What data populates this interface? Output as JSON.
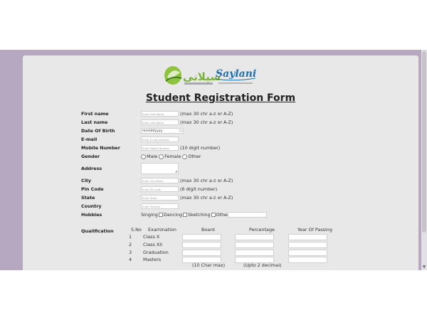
{
  "form": {
    "title": "Student Registration Form",
    "logo": {
      "urdu": "سیلانی",
      "latin": "Saylani"
    }
  },
  "fields": {
    "first_name": {
      "label": "First name",
      "placeholder": "Enter First Name",
      "hint": "(max 30 chr a-z or A-Z)"
    },
    "last_name": {
      "label": "Last name",
      "placeholder": "Enter Last Name",
      "hint": "(max 30 chr a-z or A-Z)"
    },
    "dob": {
      "label": "Date Of Birth",
      "value": "mm/dd/yyyy",
      "icon": "calendar-icon"
    },
    "email": {
      "label": "E-mail",
      "placeholder": "Enter E-mail address"
    },
    "mobile": {
      "label": "Mobile Number",
      "placeholder": "Enter Mobile Number",
      "hint": "(10 digit number)"
    },
    "gender": {
      "label": "Gender",
      "options": [
        "Male",
        "Female",
        "Other"
      ]
    },
    "address": {
      "label": "Address"
    },
    "city": {
      "label": "City",
      "placeholder": "Enter City Name",
      "hint": "(max 30 chr a-z or A-Z)"
    },
    "pin": {
      "label": "Pin Code",
      "placeholder": "Enter Pin code",
      "hint": "(6 digit number)"
    },
    "state": {
      "label": "State",
      "placeholder": "Enter State",
      "hint": "(max 30 chr a-z or A-Z)"
    },
    "country": {
      "label": "Country",
      "placeholder": "Enter Country"
    },
    "hobbies": {
      "label": "Hobbies",
      "options": [
        "Singing",
        "Dancing",
        "Sketching",
        "Other"
      ]
    }
  },
  "qualification": {
    "label": "Qualification",
    "headers": [
      "S.No",
      "Examination",
      "Board",
      "Percentage",
      "Year Of Passing"
    ],
    "rows": [
      {
        "sno": "1",
        "exam": "Class X"
      },
      {
        "sno": "2",
        "exam": "Class XII"
      },
      {
        "sno": "3",
        "exam": "Graduation"
      },
      {
        "sno": "4",
        "exam": "Masters"
      }
    ],
    "board_note": "(10 Char max)",
    "percent_note": "(Upto 2 decimal)"
  }
}
